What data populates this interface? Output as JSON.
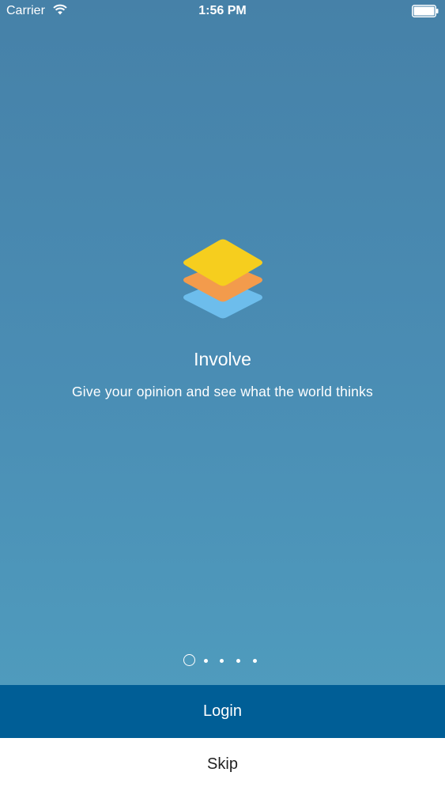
{
  "status_bar": {
    "carrier": "Carrier",
    "time": "1:56 PM",
    "wifi_icon": "wifi-icon",
    "battery_icon": "battery-icon"
  },
  "onboarding": {
    "logo_icon": "layers-icon",
    "logo_colors": {
      "top": "#f6ce1e",
      "middle": "#f39b4c",
      "bottom": "#6dbdec"
    },
    "title": "Involve",
    "subtitle": "Give your opinion and see what the world thinks",
    "page_indicator": {
      "current_page": 1,
      "total_pages": 5
    }
  },
  "actions": {
    "login_label": "Login",
    "skip_label": "Skip"
  },
  "colors": {
    "background_top": "#4681a8",
    "background_bottom": "#4f9bbd",
    "login_button": "#005e96",
    "skip_button": "#ffffff"
  }
}
